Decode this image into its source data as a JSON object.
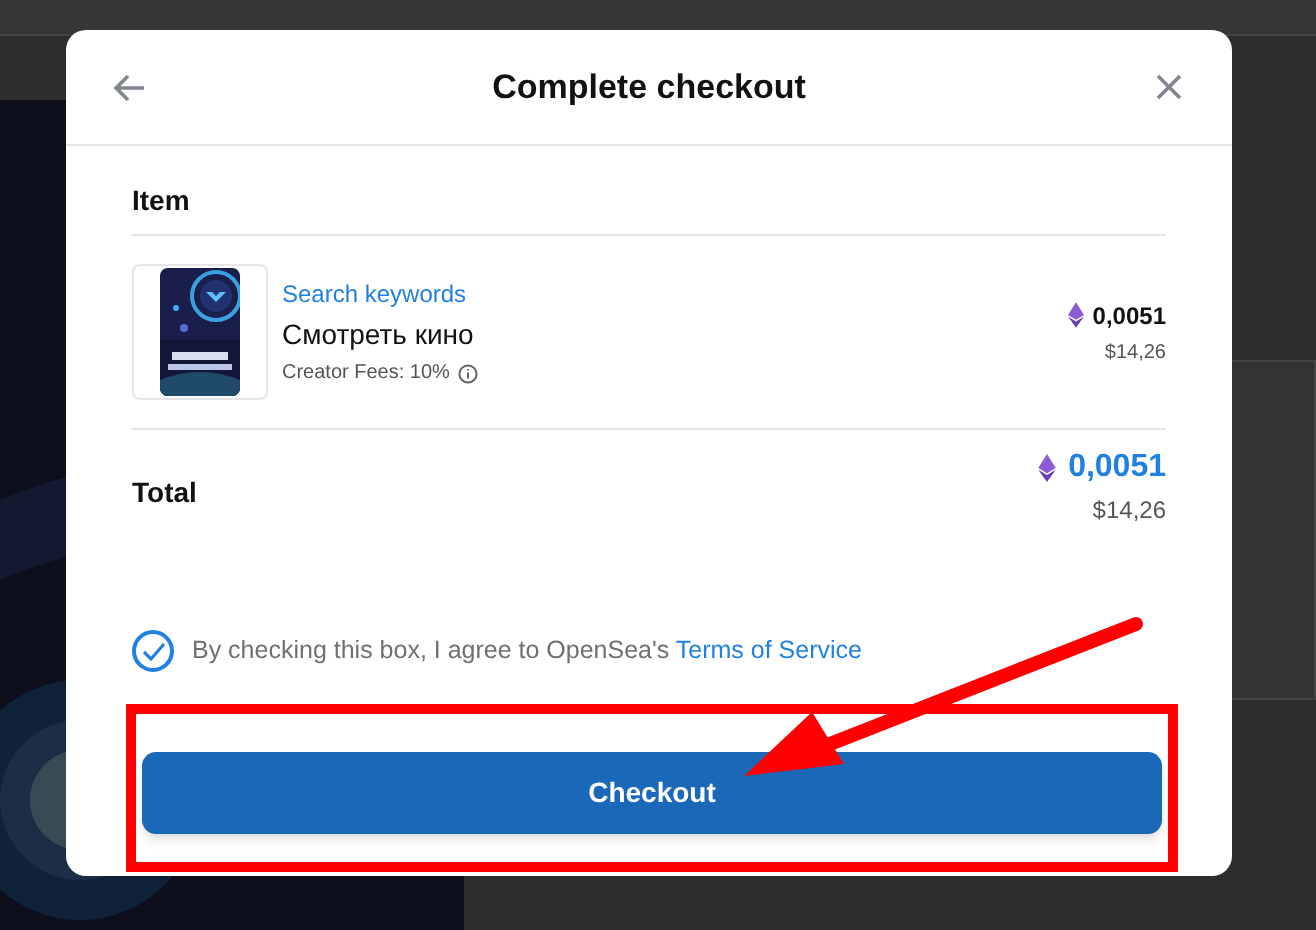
{
  "modal": {
    "title": "Complete checkout",
    "item_heading": "Item",
    "item": {
      "collection": "Search keywords",
      "name": "Смотреть кино",
      "fees": "Creator Fees: 10%",
      "price": "0,0051",
      "price_usd": "$14,26"
    },
    "total": {
      "label": "Total",
      "price": "0,0051",
      "price_usd": "$14,26"
    },
    "agreement": {
      "checked": true,
      "text": "By checking this box, I agree to OpenSea's ",
      "link": "Terms of Service"
    },
    "button": "Checkout"
  }
}
